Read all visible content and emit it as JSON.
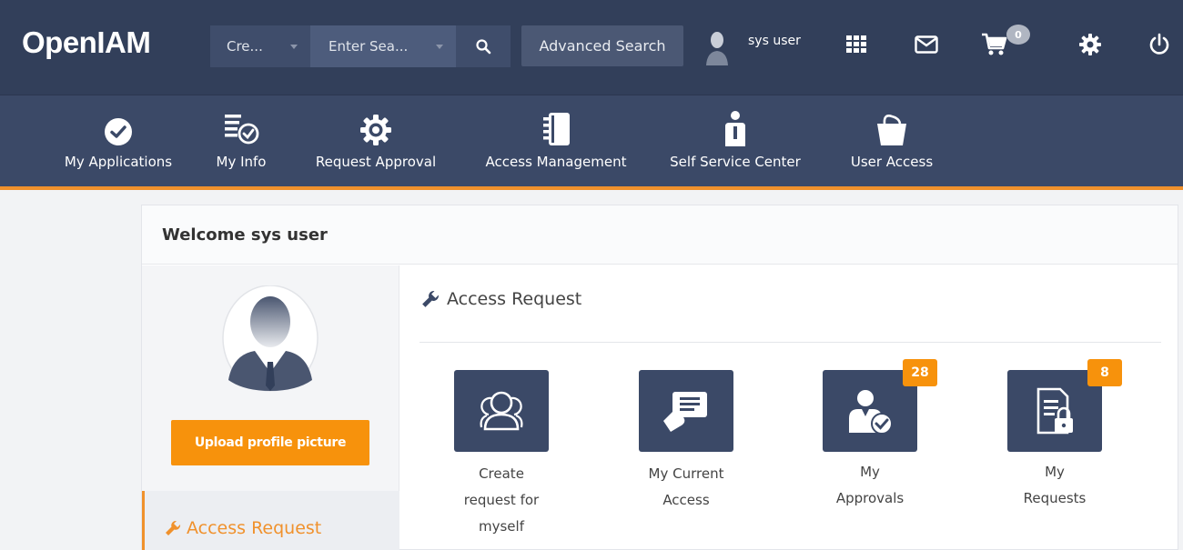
{
  "header": {
    "logo": "OpenIAM",
    "search_type": "Cre...",
    "search_placeholder": "Enter Sea...",
    "advanced_search_label": "Advanced Search",
    "user_name": "sys user",
    "cart_count": "0",
    "icons": [
      "search-icon",
      "user-avatar-icon",
      "apps-grid-icon",
      "mail-icon",
      "cart-icon",
      "gear-icon",
      "power-icon"
    ]
  },
  "nav": {
    "items": [
      {
        "label": "My Applications",
        "icon": "check-circle-icon"
      },
      {
        "label": "My Info",
        "icon": "info-list-icon"
      },
      {
        "label": "Request Approval",
        "icon": "cog-icon"
      },
      {
        "label": "Access Management",
        "icon": "address-book-icon"
      },
      {
        "label": "Self Service Center",
        "icon": "user-info-icon"
      },
      {
        "label": "User Access",
        "icon": "basket-icon"
      }
    ]
  },
  "main": {
    "welcome": "Welcome sys user",
    "upload_label": "Upload profile picture",
    "left_menu_label": "Access Request",
    "section_title": "Access Request",
    "tiles": [
      {
        "label": "Create request for myself",
        "badge": ""
      },
      {
        "label": "My Current Access",
        "badge": ""
      },
      {
        "label": "My Approvals",
        "badge": "28"
      },
      {
        "label": "My Requests",
        "badge": "8"
      }
    ]
  },
  "colors": {
    "topbar": "#323f5a",
    "navbar": "#3b4967",
    "accent": "#f0912c",
    "button": "#f7920c"
  }
}
